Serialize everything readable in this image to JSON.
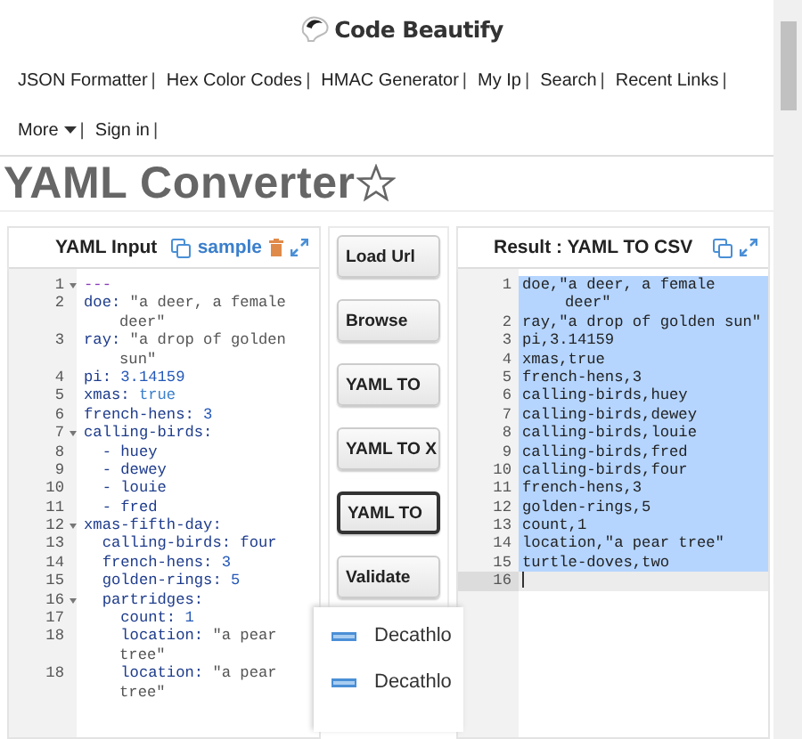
{
  "brand": {
    "name": "Code Beautify"
  },
  "nav": [
    {
      "label": "JSON Formatter",
      "separator": "|",
      "kind": "link"
    },
    {
      "label": "Hex Color Codes",
      "separator": "|",
      "kind": "link"
    },
    {
      "label": "HMAC Generator",
      "separator": "|",
      "kind": "link"
    },
    {
      "label": "My Ip",
      "separator": "|",
      "kind": "link"
    },
    {
      "label": "Search",
      "separator": "|",
      "kind": "link"
    },
    {
      "label": "Recent Links",
      "separator": "|",
      "kind": "link"
    },
    {
      "label": "More",
      "separator": "|",
      "kind": "menu"
    },
    {
      "label": "Sign in",
      "separator": "|",
      "kind": "link"
    }
  ],
  "page_title": "YAML Converter",
  "input_panel": {
    "title": "YAML Input",
    "sample_link": "sample",
    "lines": [
      {
        "number": "1",
        "foldable": true,
        "segments": [
          {
            "text": "---",
            "kind": "meta"
          }
        ]
      },
      {
        "number": "2",
        "foldable": false,
        "segments": [
          {
            "text": "doe: ",
            "kind": "key"
          },
          {
            "text": "\"a deer, a female",
            "kind": "string"
          }
        ],
        "wrap": [
          {
            "text": "deer\"",
            "kind": "string"
          }
        ]
      },
      {
        "number": "3",
        "foldable": false,
        "segments": [
          {
            "text": "ray: ",
            "kind": "key"
          },
          {
            "text": "\"a drop of golden",
            "kind": "string"
          }
        ],
        "wrap": [
          {
            "text": "sun\"",
            "kind": "string"
          }
        ]
      },
      {
        "number": "4",
        "foldable": false,
        "segments": [
          {
            "text": "pi: ",
            "kind": "key"
          },
          {
            "text": "3.14159",
            "kind": "number"
          }
        ]
      },
      {
        "number": "5",
        "foldable": false,
        "segments": [
          {
            "text": "xmas: ",
            "kind": "key"
          },
          {
            "text": "true",
            "kind": "atom"
          }
        ]
      },
      {
        "number": "6",
        "foldable": false,
        "segments": [
          {
            "text": "french-hens: ",
            "kind": "key"
          },
          {
            "text": "3",
            "kind": "number"
          }
        ]
      },
      {
        "number": "7",
        "foldable": true,
        "segments": [
          {
            "text": "calling-birds:",
            "kind": "key"
          }
        ]
      },
      {
        "number": "8",
        "foldable": false,
        "segments": [
          {
            "text": "  - huey",
            "kind": "plain"
          }
        ]
      },
      {
        "number": "9",
        "foldable": false,
        "segments": [
          {
            "text": "  - dewey",
            "kind": "plain"
          }
        ]
      },
      {
        "number": "10",
        "foldable": false,
        "segments": [
          {
            "text": "  - louie",
            "kind": "plain"
          }
        ]
      },
      {
        "number": "11",
        "foldable": false,
        "segments": [
          {
            "text": "  - fred",
            "kind": "plain"
          }
        ]
      },
      {
        "number": "12",
        "foldable": true,
        "segments": [
          {
            "text": "xmas-fifth-day:",
            "kind": "key"
          }
        ]
      },
      {
        "number": "13",
        "foldable": false,
        "segments": [
          {
            "text": "  calling-birds: ",
            "kind": "key"
          },
          {
            "text": "four",
            "kind": "plain"
          }
        ]
      },
      {
        "number": "14",
        "foldable": false,
        "segments": [
          {
            "text": "  french-hens: ",
            "kind": "key"
          },
          {
            "text": "3",
            "kind": "number"
          }
        ]
      },
      {
        "number": "15",
        "foldable": false,
        "segments": [
          {
            "text": "  golden-rings: ",
            "kind": "key"
          },
          {
            "text": "5",
            "kind": "number"
          }
        ]
      },
      {
        "number": "16",
        "foldable": true,
        "segments": [
          {
            "text": "  partridges:",
            "kind": "key"
          }
        ]
      },
      {
        "number": "17",
        "foldable": false,
        "segments": [
          {
            "text": "    count: ",
            "kind": "key"
          },
          {
            "text": "1",
            "kind": "number"
          }
        ]
      },
      {
        "number": "18",
        "foldable": false,
        "segments": [
          {
            "text": "    location: ",
            "kind": "key"
          },
          {
            "text": "\"a pear",
            "kind": "string"
          }
        ],
        "wrap": [
          {
            "text": "tree\"",
            "kind": "string"
          }
        ]
      },
      {
        "number": "18",
        "foldable": false,
        "segments": [
          {
            "text": "    location: ",
            "kind": "key"
          },
          {
            "text": "\"a pear",
            "kind": "string"
          }
        ],
        "wrap": [
          {
            "text": "tree\"",
            "kind": "string"
          }
        ]
      }
    ]
  },
  "actions": [
    {
      "label": "Load Url",
      "focused": false
    },
    {
      "label": "Browse",
      "focused": false
    },
    {
      "label": "YAML TO",
      "focused": false
    },
    {
      "label": "YAML TO X",
      "focused": false
    },
    {
      "label": "YAML TO",
      "focused": true
    },
    {
      "label": "Validate",
      "focused": false
    }
  ],
  "popup": {
    "items": [
      {
        "label": "Decathlo"
      },
      {
        "label": "Decathlo"
      }
    ]
  },
  "result_panel": {
    "title": "Result : YAML TO CSV",
    "lines": [
      {
        "number": "1",
        "text": "doe,\"a deer, a female",
        "wrap_text": "deer\"",
        "selected": true,
        "active": false
      },
      {
        "number": "2",
        "text": "ray,\"a drop of golden sun\"",
        "selected": true,
        "active": false
      },
      {
        "number": "3",
        "text": "pi,3.14159",
        "selected": true,
        "active": false
      },
      {
        "number": "4",
        "text": "xmas,true",
        "selected": true,
        "active": false
      },
      {
        "number": "5",
        "text": "french-hens,3",
        "selected": true,
        "active": false
      },
      {
        "number": "6",
        "text": "calling-birds,huey",
        "selected": true,
        "active": false
      },
      {
        "number": "7",
        "text": "calling-birds,dewey",
        "selected": true,
        "active": false
      },
      {
        "number": "8",
        "text": "calling-birds,louie",
        "selected": true,
        "active": false
      },
      {
        "number": "9",
        "text": "calling-birds,fred",
        "selected": true,
        "active": false
      },
      {
        "number": "10",
        "text": "calling-birds,four",
        "selected": true,
        "active": false
      },
      {
        "number": "11",
        "text": "french-hens,3",
        "selected": true,
        "active": false
      },
      {
        "number": "12",
        "text": "golden-rings,5",
        "selected": true,
        "active": false
      },
      {
        "number": "13",
        "text": "count,1",
        "selected": true,
        "active": false
      },
      {
        "number": "14",
        "text": "location,\"a pear tree\"",
        "selected": true,
        "active": false
      },
      {
        "number": "15",
        "text": "turtle-doves,two",
        "selected": true,
        "active": false
      },
      {
        "number": "16",
        "selected": false,
        "active": true
      }
    ]
  }
}
